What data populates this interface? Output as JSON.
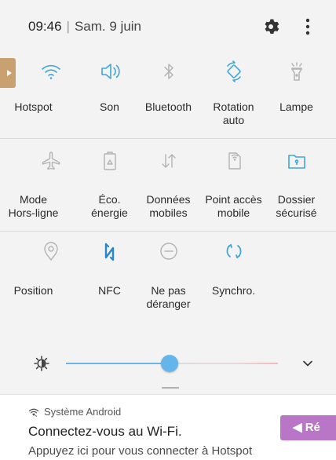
{
  "status": {
    "time": "09:46",
    "separator": "|",
    "date": "Sam. 9 juin"
  },
  "header_icons": [
    "gear-icon",
    "more-vertical-icon"
  ],
  "tiles": [
    {
      "label": "Hotspot",
      "icon": "wifi-icon",
      "active": true
    },
    {
      "label": "Son",
      "icon": "speaker-icon",
      "active": true
    },
    {
      "label": "Bluetooth",
      "icon": "bluetooth-icon",
      "active": false
    },
    {
      "label": "Rotation\nauto",
      "icon": "rotation-icon",
      "active": true
    },
    {
      "label": "Lampe",
      "icon": "flashlight-icon",
      "active": false
    },
    {
      "label": "Mode\nHors-ligne",
      "icon": "airplane-icon",
      "active": false
    },
    {
      "label": "Éco.\nénergie",
      "icon": "battery-icon",
      "active": false
    },
    {
      "label": "Données\nmobiles",
      "icon": "data-arrows-icon",
      "active": false
    },
    {
      "label": "Point accès\nmobile",
      "icon": "mobile-hotspot-icon",
      "active": false
    },
    {
      "label": "Dossier\nsécurisé",
      "icon": "secure-folder-icon",
      "active": true
    },
    {
      "label": "Position",
      "icon": "location-icon",
      "active": false
    },
    {
      "label": "NFC",
      "icon": "nfc-icon",
      "active": true
    },
    {
      "label": "Ne pas\ndéranger",
      "icon": "do-not-disturb-icon",
      "active": false
    },
    {
      "label": "Synchro.",
      "icon": "sync-icon",
      "active": true
    }
  ],
  "brightness": {
    "level": 0.49
  },
  "notification": {
    "app": "Système Android",
    "title": "Connectez-vous au Wi-Fi.",
    "body": "Appuyez ici pour vous connecter à  Hotspot"
  },
  "reply_button": {
    "label": "◀ Ré"
  },
  "colors": {
    "active": "#3fa6db",
    "inactive": "#b3b3b3",
    "nfc": "#2a86c9",
    "reply": "#b976c7"
  }
}
